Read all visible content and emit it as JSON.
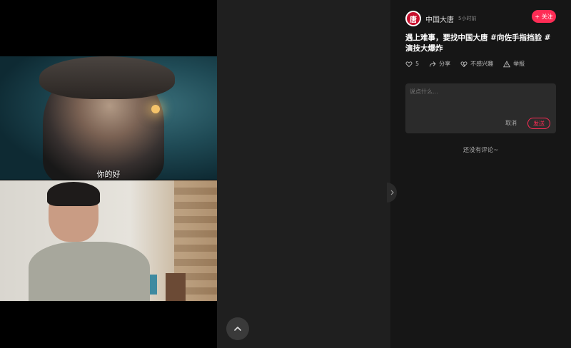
{
  "video": {
    "subtitle": "你的好"
  },
  "post": {
    "author": "中国大唐",
    "avatar_glyph": "唐",
    "time": "5小时前",
    "follow_label": "+ 关注",
    "description": "遇上难事，要找中国大唐 #向佐手指挡脸 #演技大爆炸",
    "actions": {
      "like_count": "5",
      "share_label": "分享",
      "not_interested_label": "不感兴趣",
      "report_label": "举报"
    }
  },
  "comment": {
    "placeholder": "说点什么...",
    "cancel_label": "取消",
    "send_label": "发送",
    "empty_text": "还没有评论~"
  },
  "colors": {
    "accent": "#fe2c55",
    "background": "#161616"
  }
}
